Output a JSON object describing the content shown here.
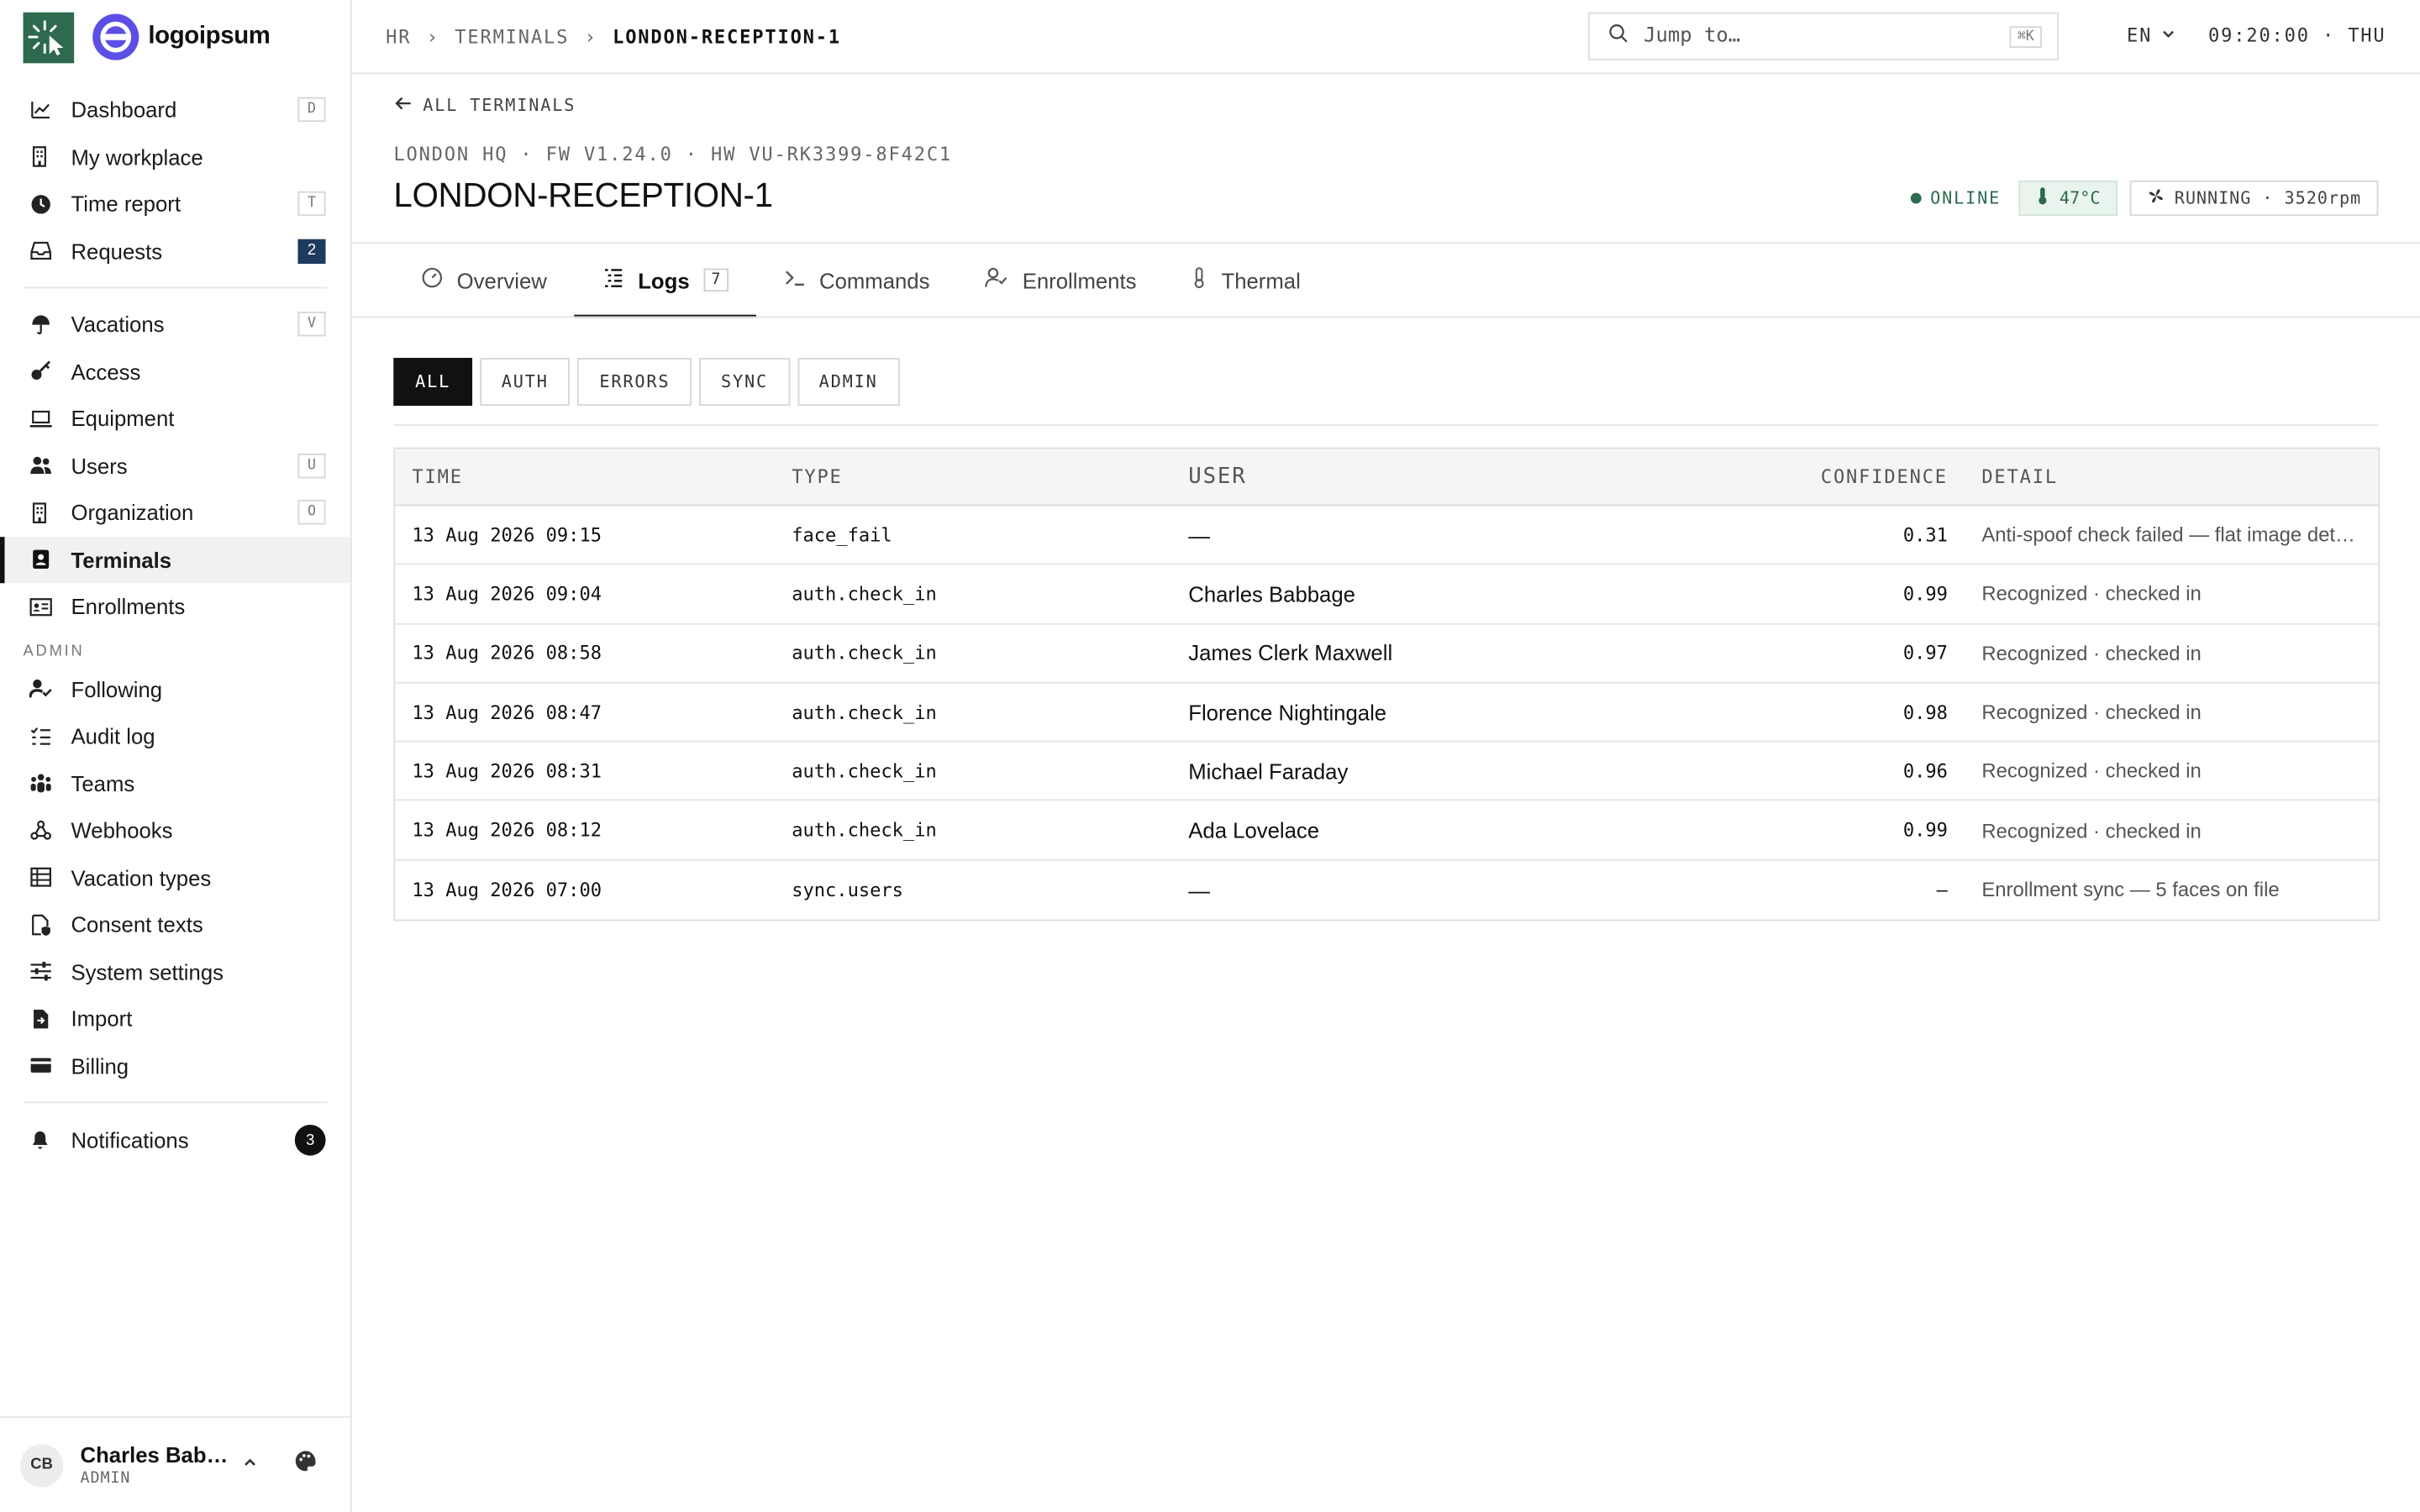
{
  "brand": {
    "name": "logoipsum"
  },
  "sidebar": {
    "primary": [
      {
        "label": "Dashboard",
        "key": "D",
        "icon": "chart-line-icon"
      },
      {
        "label": "My workplace",
        "key": "",
        "icon": "building-icon"
      },
      {
        "label": "Time report",
        "key": "T",
        "icon": "clock-icon"
      },
      {
        "label": "Requests",
        "count": "2",
        "icon": "inbox-icon"
      }
    ],
    "secondary": [
      {
        "label": "Vacations",
        "key": "V",
        "icon": "umbrella-icon"
      },
      {
        "label": "Access",
        "key": "",
        "icon": "key-icon"
      },
      {
        "label": "Equipment",
        "key": "",
        "icon": "laptop-icon"
      },
      {
        "label": "Users",
        "key": "U",
        "icon": "users-icon"
      },
      {
        "label": "Organization",
        "key": "O",
        "icon": "building-icon"
      },
      {
        "label": "Terminals",
        "key": "",
        "icon": "badge-icon",
        "active": true
      },
      {
        "label": "Enrollments",
        "key": "",
        "icon": "id-card-icon"
      }
    ],
    "admin_label": "ADMIN",
    "admin": [
      {
        "label": "Following",
        "icon": "user-check-icon"
      },
      {
        "label": "Audit log",
        "icon": "list-check-icon"
      },
      {
        "label": "Teams",
        "icon": "team-icon"
      },
      {
        "label": "Webhooks",
        "icon": "webhook-icon"
      },
      {
        "label": "Vacation types",
        "icon": "table-icon"
      },
      {
        "label": "Consent texts",
        "icon": "file-shield-icon"
      },
      {
        "label": "System settings",
        "icon": "sliders-icon"
      },
      {
        "label": "Import",
        "icon": "file-import-icon"
      },
      {
        "label": "Billing",
        "icon": "credit-card-icon"
      }
    ],
    "notifications": {
      "label": "Notifications",
      "count": "3"
    },
    "user": {
      "initials": "CB",
      "name": "Charles Babbage",
      "role": "ADMIN"
    }
  },
  "topbar": {
    "crumbs": [
      "HR",
      "TERMINALS",
      "LONDON-RECEPTION-1"
    ],
    "separator": "›",
    "search_placeholder": "Jump to…",
    "search_shortcut": "⌘K",
    "lang": "EN",
    "clock": "09:20:00 · THU"
  },
  "header": {
    "back_label": "ALL TERMINALS",
    "meta": "LONDON HQ · FW V1.24.0 · HW VU-RK3399-8F42C1",
    "title": "LONDON-RECEPTION-1",
    "status": "ONLINE",
    "temp": "47°C",
    "fan": "RUNNING · 3520rpm",
    "status_color": "#2d6a4f"
  },
  "tabs": [
    {
      "label": "Overview",
      "icon": "gauge-icon"
    },
    {
      "label": "Logs",
      "icon": "logs-icon",
      "badge": "7",
      "active": true
    },
    {
      "label": "Commands",
      "icon": "terminal-icon"
    },
    {
      "label": "Enrollments",
      "icon": "user-check-icon"
    },
    {
      "label": "Thermal",
      "icon": "thermometer-icon"
    }
  ],
  "filters": [
    "ALL",
    "AUTH",
    "ERRORS",
    "SYNC",
    "ADMIN"
  ],
  "table": {
    "columns": {
      "time": "TIME",
      "type": "TYPE",
      "user": "USER",
      "confidence": "CONFIDENCE",
      "detail": "DETAIL"
    },
    "rows": [
      {
        "time": "13 Aug 2026 09:15",
        "type": "face_fail",
        "user": "—",
        "confidence": "0.31",
        "detail": "Anti-spoof check failed — flat image detected"
      },
      {
        "time": "13 Aug 2026 09:04",
        "type": "auth.check_in",
        "user": "Charles Babbage",
        "confidence": "0.99",
        "detail": "Recognized · checked in"
      },
      {
        "time": "13 Aug 2026 08:58",
        "type": "auth.check_in",
        "user": "James Clerk Maxwell",
        "confidence": "0.97",
        "detail": "Recognized · checked in"
      },
      {
        "time": "13 Aug 2026 08:47",
        "type": "auth.check_in",
        "user": "Florence Nightingale",
        "confidence": "0.98",
        "detail": "Recognized · checked in"
      },
      {
        "time": "13 Aug 2026 08:31",
        "type": "auth.check_in",
        "user": "Michael Faraday",
        "confidence": "0.96",
        "detail": "Recognized · checked in"
      },
      {
        "time": "13 Aug 2026 08:12",
        "type": "auth.check_in",
        "user": "Ada Lovelace",
        "confidence": "0.99",
        "detail": "Recognized · checked in"
      },
      {
        "time": "13 Aug 2026 07:00",
        "type": "sync.users",
        "user": "—",
        "confidence": "–",
        "detail": "Enrollment sync — 5 faces on file"
      }
    ]
  }
}
